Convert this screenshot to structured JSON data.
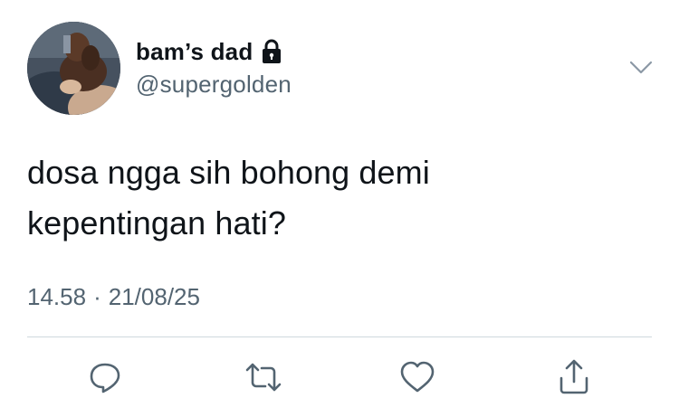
{
  "user": {
    "display_name": "bam’s dad",
    "handle": "@supergolden",
    "protected_icon": "lock-icon",
    "avatar": "avatar-photo-dog"
  },
  "tweet": {
    "text_lines": [
      "dosa ngga sih bohong demi",
      "kepentingan hati?"
    ],
    "time": "14.58",
    "separator": "·",
    "date": "21/08/25"
  },
  "actions": [
    {
      "name": "reply",
      "icon": "reply-icon"
    },
    {
      "name": "retweet",
      "icon": "retweet-icon"
    },
    {
      "name": "like",
      "icon": "heart-icon"
    },
    {
      "name": "share",
      "icon": "share-icon"
    }
  ],
  "menu_icon": "chevron-down-icon",
  "colors": {
    "text_primary": "#0f1419",
    "text_secondary": "#536471",
    "divider": "#cfd9de"
  }
}
